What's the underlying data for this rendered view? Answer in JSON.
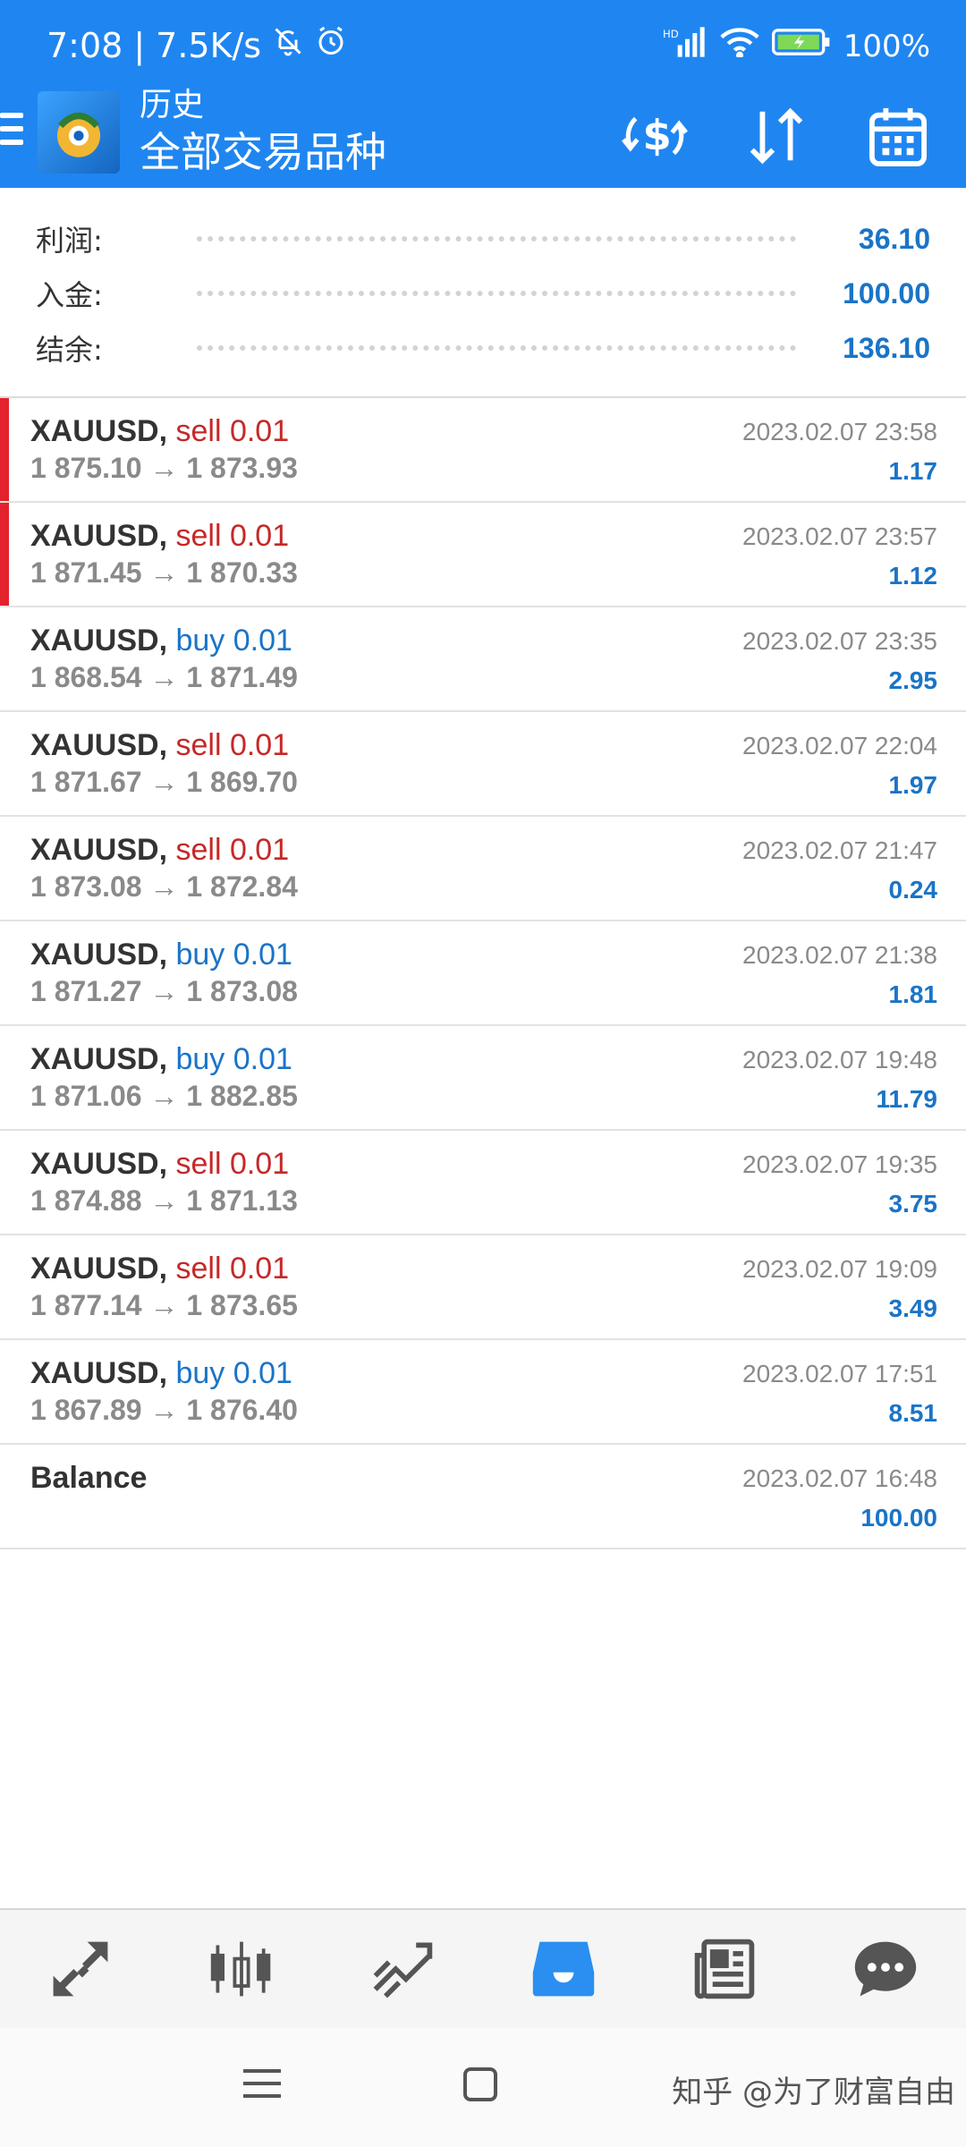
{
  "status_bar": {
    "time": "7:08",
    "separator": "|",
    "speed": "7.5K/s",
    "battery": "100%"
  },
  "app_bar": {
    "title_small": "历史",
    "title_big": "全部交易品种",
    "icons": [
      "menu-icon",
      "app-logo-icon",
      "currency-exchange-icon",
      "sort-icon",
      "calendar-icon"
    ]
  },
  "summary": {
    "profit_label": "利润:",
    "profit_value": "36.10",
    "deposit_label": "入金:",
    "deposit_value": "100.00",
    "balance_label": "结余:",
    "balance_value": "136.10"
  },
  "colors": {
    "accent": "#1f86f1",
    "sell": "#c62828",
    "buy": "#1a74c7",
    "marker": "#e3222b"
  },
  "history": [
    {
      "symbol": "XAUUSD,",
      "direction": "sell",
      "dir_text": "sell 0.01",
      "prices": "1 875.10 → 1 873.93",
      "time": "2023.02.07 23:58",
      "profit": "1.17",
      "highlight": true
    },
    {
      "symbol": "XAUUSD,",
      "direction": "sell",
      "dir_text": "sell 0.01",
      "prices": "1 871.45 → 1 870.33",
      "time": "2023.02.07 23:57",
      "profit": "1.12",
      "highlight": true
    },
    {
      "symbol": "XAUUSD,",
      "direction": "buy",
      "dir_text": "buy 0.01",
      "prices": "1 868.54 → 1 871.49",
      "time": "2023.02.07 23:35",
      "profit": "2.95",
      "highlight": false
    },
    {
      "symbol": "XAUUSD,",
      "direction": "sell",
      "dir_text": "sell 0.01",
      "prices": "1 871.67 → 1 869.70",
      "time": "2023.02.07 22:04",
      "profit": "1.97",
      "highlight": false
    },
    {
      "symbol": "XAUUSD,",
      "direction": "sell",
      "dir_text": "sell 0.01",
      "prices": "1 873.08 → 1 872.84",
      "time": "2023.02.07 21:47",
      "profit": "0.24",
      "highlight": false
    },
    {
      "symbol": "XAUUSD,",
      "direction": "buy",
      "dir_text": "buy 0.01",
      "prices": "1 871.27 → 1 873.08",
      "time": "2023.02.07 21:38",
      "profit": "1.81",
      "highlight": false
    },
    {
      "symbol": "XAUUSD,",
      "direction": "buy",
      "dir_text": "buy 0.01",
      "prices": "1 871.06 → 1 882.85",
      "time": "2023.02.07 19:48",
      "profit": "11.79",
      "highlight": false
    },
    {
      "symbol": "XAUUSD,",
      "direction": "sell",
      "dir_text": "sell 0.01",
      "prices": "1 874.88 → 1 871.13",
      "time": "2023.02.07 19:35",
      "profit": "3.75",
      "highlight": false
    },
    {
      "symbol": "XAUUSD,",
      "direction": "sell",
      "dir_text": "sell 0.01",
      "prices": "1 877.14 → 1 873.65",
      "time": "2023.02.07 19:09",
      "profit": "3.49",
      "highlight": false
    },
    {
      "symbol": "XAUUSD,",
      "direction": "buy",
      "dir_text": "buy 0.01",
      "prices": "1 867.89 → 1 876.40",
      "time": "2023.02.07 17:51",
      "profit": "8.51",
      "highlight": false
    },
    {
      "symbol": "Balance",
      "direction": "",
      "dir_text": "",
      "prices": "",
      "time": "2023.02.07 16:48",
      "profit": "100.00",
      "highlight": false
    }
  ],
  "bottom_nav": {
    "items": [
      "quotes-icon",
      "chart-icon",
      "trade-icon",
      "history-icon",
      "news-icon",
      "chat-icon"
    ],
    "active": "history-icon"
  },
  "watermark": "知乎 @为了财富自由"
}
